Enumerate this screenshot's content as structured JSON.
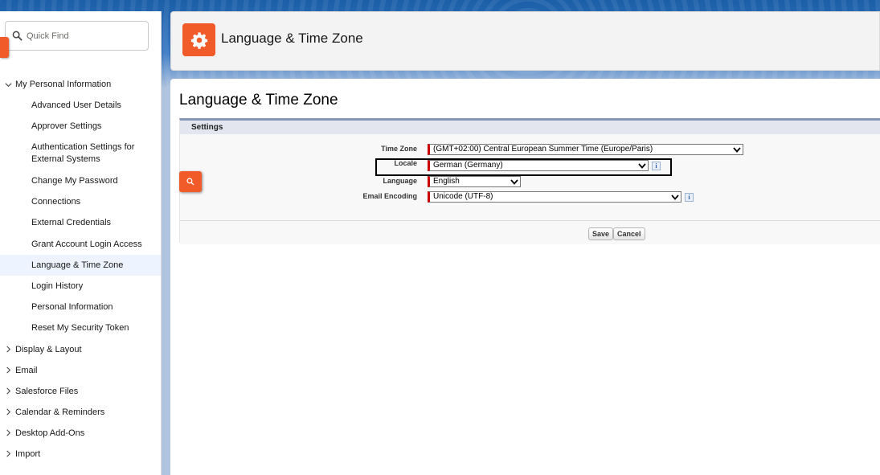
{
  "quick_find": {
    "placeholder": "Quick Find",
    "value": ""
  },
  "sidebar": {
    "group_open": "My Personal Information",
    "items": [
      "Advanced User Details",
      "Approver Settings",
      "Authentication Settings for External Systems",
      "Change My Password",
      "Connections",
      "External Credentials",
      "Grant Account Login Access",
      "Language & Time Zone",
      "Login History",
      "Personal Information",
      "Reset My Security Token"
    ],
    "active_item": "Language & Time Zone",
    "groups_collapsed": [
      "Display & Layout",
      "Email",
      "Salesforce Files",
      "Calendar & Reminders",
      "Desktop Add-Ons",
      "Import"
    ]
  },
  "header": {
    "title": "Language & Time Zone",
    "icon": "gear-icon"
  },
  "main": {
    "title": "Language & Time Zone",
    "section": "Settings",
    "fields": {
      "time_zone": {
        "label": "Time Zone",
        "value": "(GMT+02:00) Central European Summer Time (Europe/Paris)"
      },
      "locale": {
        "label": "Locale",
        "value": "German (Germany)"
      },
      "language": {
        "label": "Language",
        "value": "English"
      },
      "email_encoding": {
        "label": "Email Encoding",
        "value": "Unicode (UTF-8)"
      }
    },
    "buttons": {
      "save": "Save",
      "cancel": "Cancel"
    },
    "info_glyph": "i"
  },
  "colors": {
    "accent": "#f15a29",
    "required": "#cc0000",
    "panel_border": "#8596b6"
  }
}
